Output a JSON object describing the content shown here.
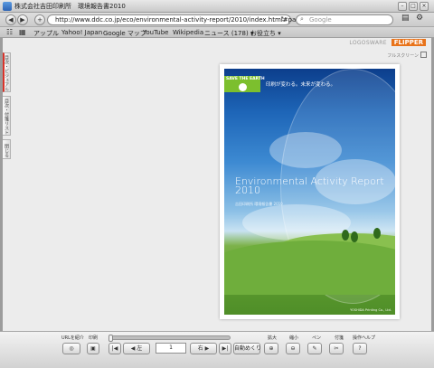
{
  "window": {
    "title": "株式会社吉田印刷所　環境報告書2010",
    "buttons": [
      "minimize",
      "maximize",
      "close"
    ]
  },
  "nav": {
    "back_icon": "◀",
    "forward_icon": "▶",
    "add_icon": "+",
    "url": "http://www.ddc.co.jp/eco/environmental-activity-report/2010/index.html#page=1",
    "reload_icon": "↻",
    "search_placeholder": "Google",
    "search_icon": "⌕",
    "page_menu_icon": "▤",
    "settings_icon": "⚙"
  },
  "bookmarks": {
    "items": [
      "アップル",
      "Yahoo! Japan",
      "Google マップ",
      "YouTube",
      "Wikipedia",
      "ニュース (178) ▾",
      "お役立ち ▾"
    ]
  },
  "viewer": {
    "brand_logoware": "LOGOSWARE",
    "brand_flipper": "FLIPPER",
    "fullscreen_label": "フルスクリーン",
    "side_tabs": [
      "目次・ビジュアル",
      "目次・付箋リスト",
      "閉じる"
    ]
  },
  "cover": {
    "badge": "SAVE THE EARTH",
    "tagline": "印刷が変わる。未来が変わる。",
    "title": "Environmental Activity Report 2010",
    "subtitle": "吉田印刷所 環境報告書 2010",
    "footer": "YOSHIDA Printing Co., Ltd."
  },
  "toolbar": {
    "labels": {
      "share": "URLを紹介",
      "print": "印刷",
      "zoom_in": "拡大",
      "zoom_out": "縮小",
      "pen": "ペン",
      "sticky": "付箋",
      "help": "操作ヘルプ"
    },
    "page_value": "1",
    "right_button": "右 ▶",
    "left_button": "◀ 左",
    "auto_flip": "自動めくり",
    "share_icon": "◎",
    "print_icon": "▣",
    "zoom_in_icon": "⊕",
    "zoom_out_icon": "⊖",
    "pen_icon": "✎",
    "sticky_icon": "✂",
    "help_icon": "?",
    "first_icon": "|◀",
    "last_icon": "▶|"
  }
}
